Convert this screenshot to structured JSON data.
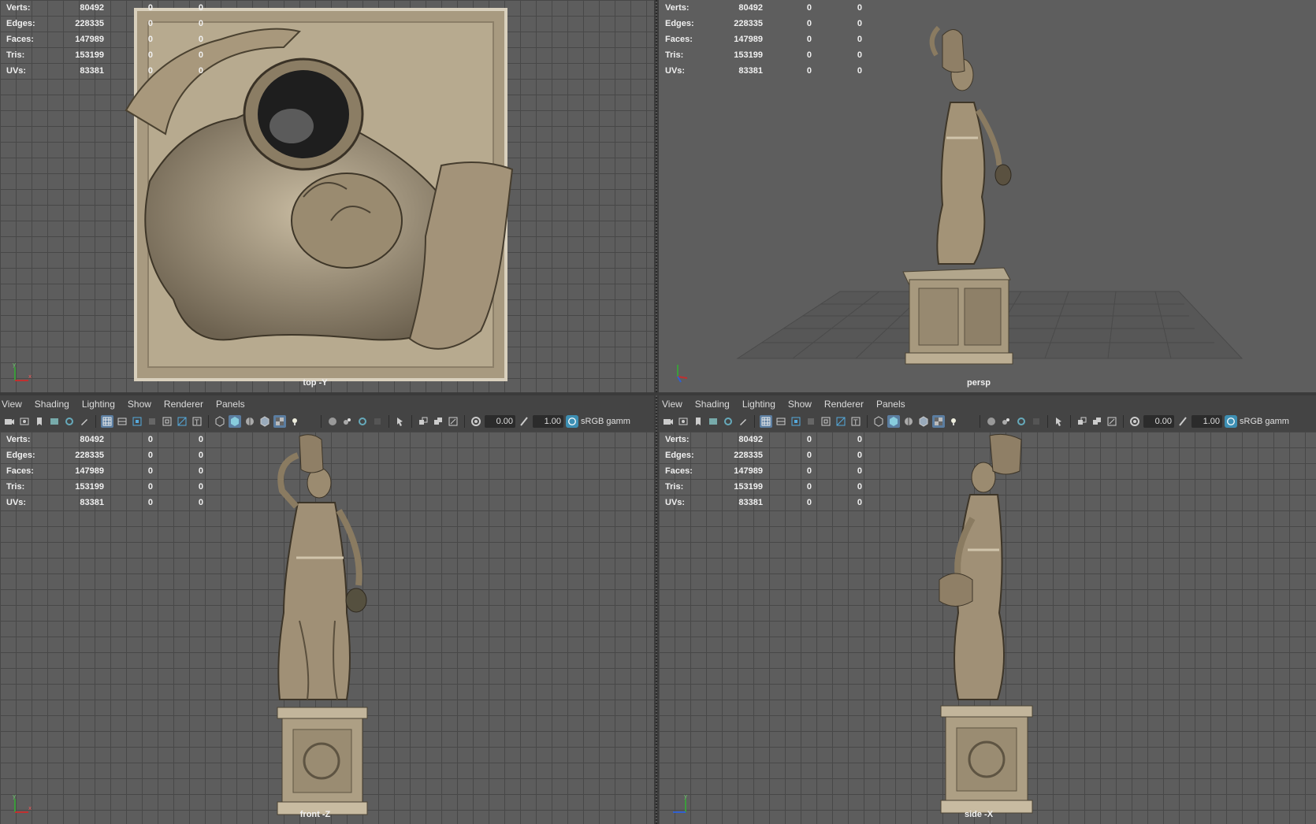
{
  "stats": {
    "labels": [
      "Verts:",
      "Edges:",
      "Faces:",
      "Tris:",
      "UVs:"
    ],
    "values": [
      "80492",
      "228335",
      "147989",
      "153199",
      "83381"
    ],
    "zero": "0"
  },
  "viewports": {
    "top": {
      "camera": "top -Y"
    },
    "persp": {
      "camera": "persp"
    },
    "front": {
      "camera": "front -Z"
    },
    "side": {
      "camera": "side -X"
    }
  },
  "menu": [
    "View",
    "Shading",
    "Lighting",
    "Show",
    "Renderer",
    "Panels"
  ],
  "toolbar": {
    "exposure": "0.00",
    "gamma": "1.00",
    "color_space": "sRGB gamm"
  },
  "colors": {
    "viewport_bg": "#5d5d5d",
    "grid_line": "#484848",
    "stone": "#a89a80",
    "hud_text": "#f0f0f0",
    "active_icon": "#5b7da0",
    "color_mgmt": "#3d8fb3"
  },
  "icons": [
    "camera-icon",
    "grid-icon",
    "shaded-icon",
    "wireframe-icon",
    "light-icon",
    "isolate-icon",
    "exposure-icon",
    "gamma-icon",
    "color-management-icon"
  ]
}
